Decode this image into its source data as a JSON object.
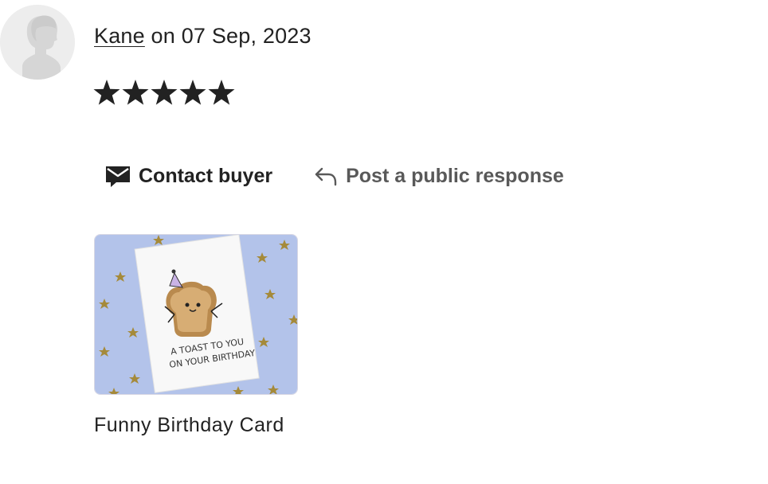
{
  "review": {
    "reviewer_name": "Kane",
    "date_text": " on 07 Sep, 2023",
    "rating": 5,
    "rating_max": 5,
    "actions": {
      "contact_label": "Contact buyer",
      "respond_label": "Post a public response"
    },
    "listing": {
      "title": "Funny Birthday Card",
      "image_text_line1": "A TOAST TO YOU",
      "image_text_line2": "ON YOUR BIRTHDAY"
    }
  },
  "colors": {
    "text": "#222222",
    "muted_text": "#595959",
    "star": "#222222",
    "avatar_bg": "#ededed",
    "image_bg": "#b3c3ea"
  },
  "icons": {
    "avatar": "person-silhouette-icon",
    "contact": "envelope-icon",
    "respond": "reply-arrow-icon",
    "star": "star-icon"
  }
}
